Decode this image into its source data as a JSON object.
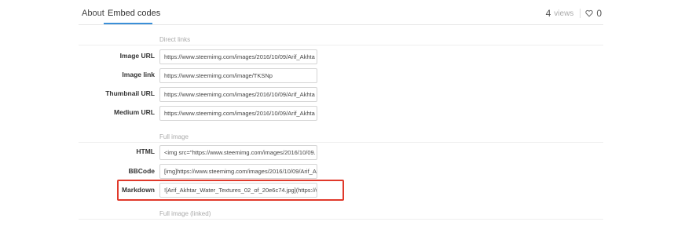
{
  "tabs": {
    "about": "About",
    "embed_codes": "Embed codes"
  },
  "stats": {
    "views_count": "4",
    "views_label": "views",
    "likes_count": "0"
  },
  "sections": {
    "direct_links": "Direct links",
    "full_image": "Full image",
    "full_image_linked": "Full image (linked)"
  },
  "direct_links": [
    {
      "label": "Image URL",
      "value": "https://www.steemimg.com/images/2016/10/09/Arif_Akhta"
    },
    {
      "label": "Image link",
      "value": "https://www.steemimg.com/image/TKSNp"
    },
    {
      "label": "Thumbnail URL",
      "value": "https://www.steemimg.com/images/2016/10/09/Arif_Akhta"
    },
    {
      "label": "Medium URL",
      "value": "https://www.steemimg.com/images/2016/10/09/Arif_Akhta"
    }
  ],
  "full_image": [
    {
      "label": "HTML",
      "value": "<img src=\"https://www.steemimg.com/images/2016/10/09."
    },
    {
      "label": "BBCode",
      "value": "[img]https://www.steemimg.com/images/2016/10/09/Arif_A"
    },
    {
      "label": "Markdown",
      "value": "![Arif_Akhtar_Water_Textures_02_of_20e6c74.jpg](https://w"
    }
  ],
  "colors": {
    "accent": "#3a8fd8",
    "highlight": "#e0392b"
  }
}
